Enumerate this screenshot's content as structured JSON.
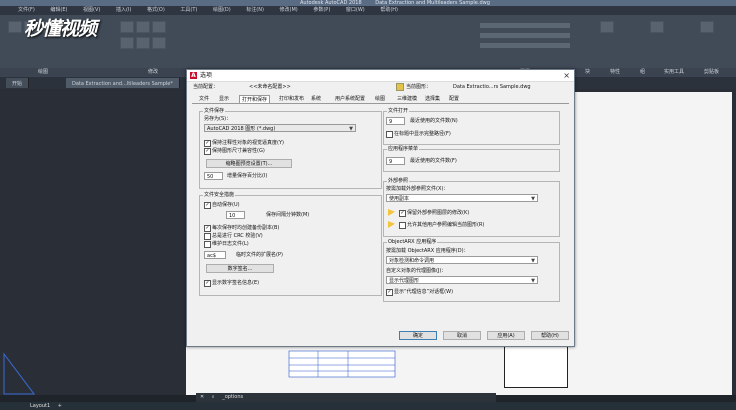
{
  "app": {
    "title_fragments": [
      "Autodesk AutoCAD 2018",
      "Data Extraction and Multileaders Sample.dwg"
    ],
    "menu": [
      "文件(F)",
      "编辑(E)",
      "视图(V)",
      "插入(I)",
      "格式(O)",
      "工具(T)",
      "绘图(D)",
      "标注(N)",
      "修改(M)",
      "参数(P)",
      "窗口(W)",
      "帮助(H)"
    ],
    "panels": [
      "绘图",
      "修改",
      "图层",
      "块",
      "特性",
      "组",
      "实用工具",
      "剪贴板"
    ],
    "tabs": [
      "开始",
      "Data Extraction and...ltileaders Sample*"
    ],
    "logo": "秒懂视频",
    "command": "_options",
    "layout": "Layout1"
  },
  "dialog": {
    "title": "选项",
    "close": "×",
    "profile_label": "当前配置：",
    "profile_value": "<<未命名配置>>",
    "drawing_label": "当前图形：",
    "drawing_value": "Data Extractio...rs Sample.dwg",
    "tabs": [
      "文件",
      "显示",
      "打开和保存",
      "打印和发布",
      "系统",
      "用户系统配置",
      "绘图",
      "三维建模",
      "选择集",
      "配置"
    ],
    "active_tab": "打开和保存",
    "file_save": {
      "title": "文件保存",
      "saveas_label": "另存为(S)：",
      "saveas_value": "AutoCAD 2018 图形 (*.dwg)",
      "keep_annot": "保持注释性对象的视觉逼真度(Y)",
      "keep_size": "保持图形尺寸兼容性(G)",
      "thumb_button": "缩略图预览设置(T)...",
      "incr_value": "50",
      "incr_label": "增量保存百分比(I)"
    },
    "safety": {
      "title": "文件安全措施",
      "autosave": "自动保存(U)",
      "minutes_value": "10",
      "minutes_label": "保存间隔分钟数(M)",
      "backup": "每次保存时均创建备份副本(B)",
      "crc": "总是进行 CRC 校验(V)",
      "log": "维护日志文件(L)",
      "ext_value": "ac$",
      "ext_label": "临时文件的扩展名(P)",
      "sign_button": "数字签名...",
      "show_sign": "显示数字签名信息(E)"
    },
    "file_open": {
      "title": "文件打开",
      "recent_value": "9",
      "recent_label": "最近使用的文件数(N)",
      "fullpath": "在标题中显示完整路径(F)"
    },
    "app_menu": {
      "title": "应用程序菜单",
      "recent_value": "9",
      "recent_label": "最近使用的文件数(F)"
    },
    "xref": {
      "title": "外部参照",
      "demand_label": "按需加载外部参照文件(X)：",
      "demand_value": "使用副本",
      "keep_layers": "保留外部参照图层的修改(K)",
      "allow_edit": "允许其他用户参照编辑当前图形(R)"
    },
    "arx": {
      "title": "ObjectARX 应用程序",
      "load_label": "按需加载 ObjectARX 应用程序(D)：",
      "load_value": "对象检测和命令调用",
      "proxy_label": "自定义对象的代理图像(J)：",
      "proxy_value": "显示代理图形",
      "proxy_info": "显示“代理信息”对话框(W)"
    },
    "buttons": {
      "ok": "确定",
      "cancel": "取消",
      "apply": "应用(A)",
      "help": "帮助(H)"
    }
  },
  "colors": {
    "accent": "#c8102e",
    "ui_dark": "#2f3641",
    "dialog_bg": "#f0f0f0"
  }
}
